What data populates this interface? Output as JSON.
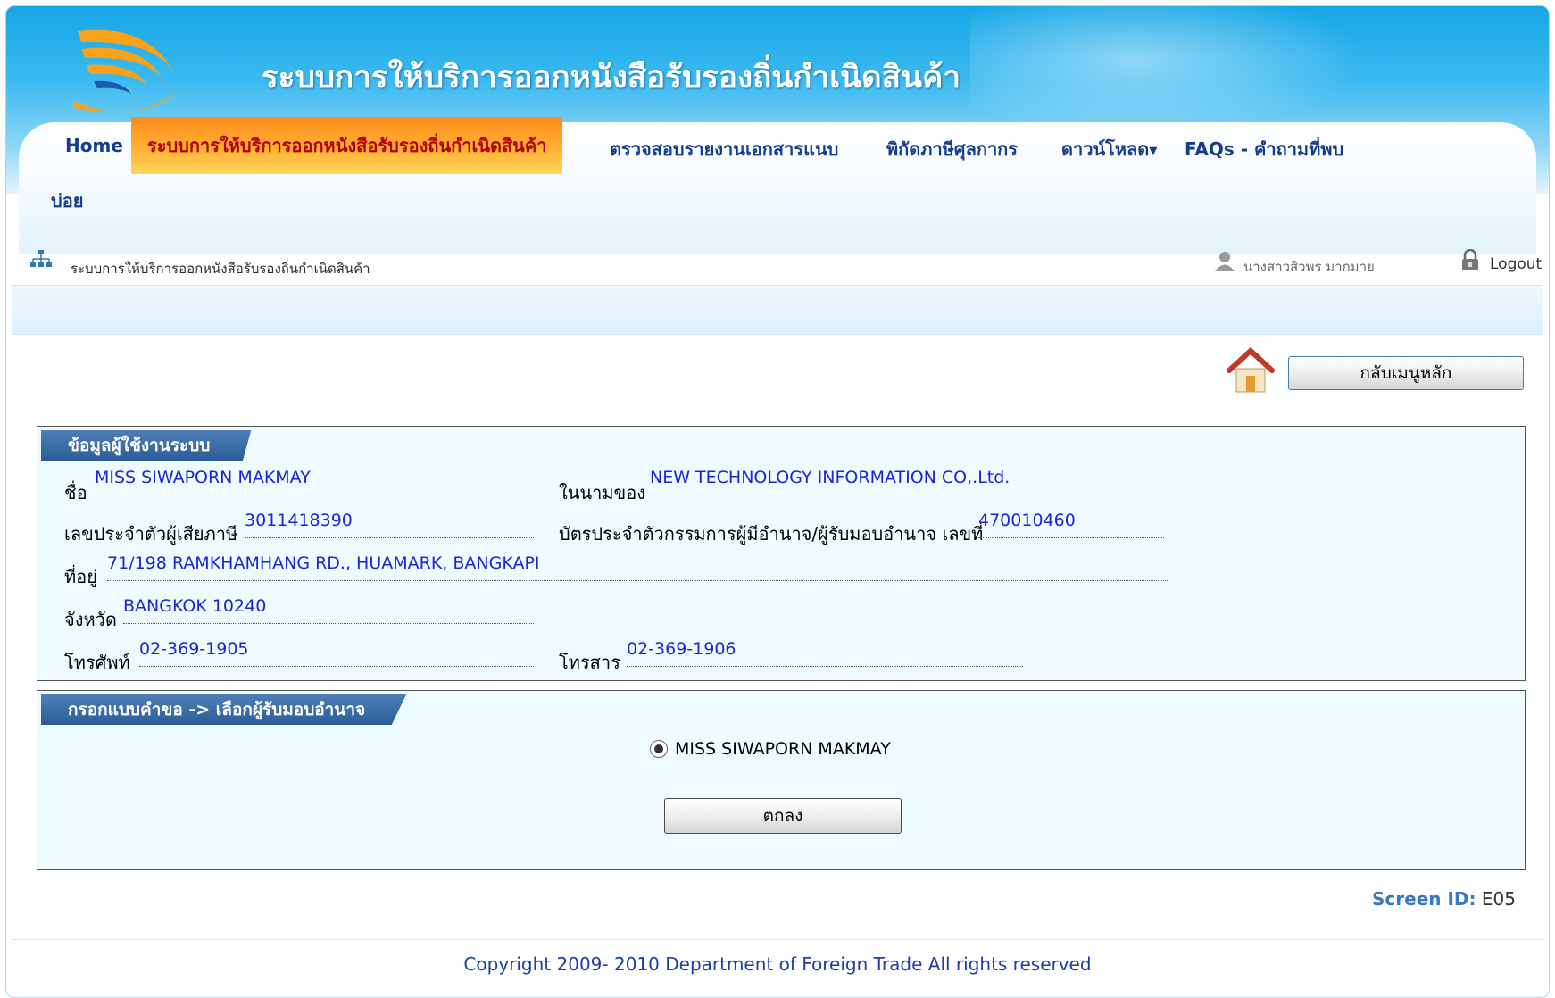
{
  "header": {
    "app_title": "ระบบการให้บริการออกหนังสือรับรองถิ่นกำเนิดสินค้า"
  },
  "nav": {
    "items": [
      {
        "label": "Home"
      },
      {
        "label": "ระบบการให้บริการออกหนังสือรับรองถิ่นกำเนิดสินค้า",
        "active": true
      },
      {
        "label": "ตรวจสอบรายงานเอกสารแนบ"
      },
      {
        "label": "พิกัดภาษีศุลกากร"
      },
      {
        "label": "ดาวน์โหลด",
        "has_dropdown": true
      },
      {
        "label": "FAQs - คำถามที่พบ"
      }
    ],
    "wrap_label": "บ่อย"
  },
  "breadcrumb": {
    "text": "ระบบการให้บริการออกหนังสือรับรองถิ่นกำเนิดสินค้า"
  },
  "user": {
    "name": "นางสาวสิวพร มากมาย",
    "logout_label": "Logout"
  },
  "actions": {
    "main_menu_label": "กลับเมนูหลัก"
  },
  "user_info": {
    "tab_title": "ข้อมูลผู้ใช้งานระบบ",
    "name_label": "ชื่อ",
    "name_value": "MISS SIWAPORN MAKMAY",
    "on_behalf_label": "ในนามของ",
    "on_behalf_value": "NEW TECHNOLOGY INFORMATION CO,.Ltd.",
    "tax_id_label": "เลขประจำตัวผู้เสียภาษี",
    "tax_id_value": "3011418390",
    "director_id_label": "บัตรประจำตัวกรรมการผู้มีอำนาจ/ผู้รับมอบอำนาจ เลขที่",
    "director_id_value": "470010460",
    "address_label": "ที่อยู่",
    "address_value": "71/198 RAMKHAMHANG RD., HUAMARK, BANGKAPI",
    "province_label": "จังหวัด",
    "province_value": "BANGKOK 10240",
    "phone_label": "โทรศัพท์",
    "phone_value": "02-369-1905",
    "fax_label": "โทรสาร",
    "fax_value": "02-369-1906"
  },
  "select_agent": {
    "tab_title": "กรอกแบบคำขอ -> เลือกผู้รับมอบอำนาจ",
    "option_label": "MISS SIWAPORN MAKMAY",
    "ok_label": "ตกลง"
  },
  "screen": {
    "id_label": "Screen ID:",
    "id_value": "E05"
  },
  "footer": {
    "copyright": "Copyright 2009- 2010 Department of Foreign Trade All rights reserved"
  },
  "colors": {
    "header_blue": "#15a6e6",
    "active_tab_orange": "#ffb437",
    "value_blue": "#1b24d8",
    "panel_bg": "#effcff",
    "tab_blue": "#2d5c98"
  },
  "icons": {
    "logo": "dft-swirl-logo",
    "breadcrumb": "sitemap-icon",
    "user": "user-icon",
    "logout": "lock-icon",
    "home": "home-icon"
  }
}
